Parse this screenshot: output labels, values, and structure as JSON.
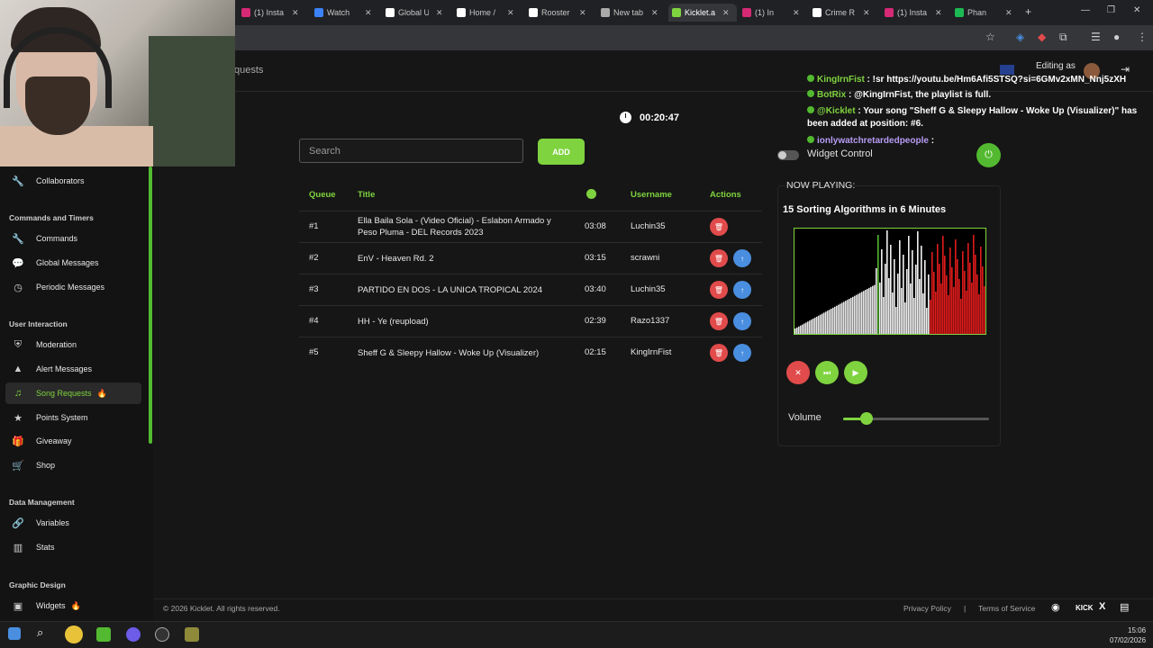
{
  "browser": {
    "tabs": [
      {
        "label": "(1) Insta",
        "color": "#d62976"
      },
      {
        "label": "Watch",
        "color": "#3b82f6"
      },
      {
        "label": "Global U",
        "color": "#ffffff"
      },
      {
        "label": "Home /",
        "color": "#ffffff"
      },
      {
        "label": "Rooster",
        "color": "#ffffff"
      },
      {
        "label": "New tab",
        "color": "#aaaaaa"
      },
      {
        "label": "Kicklet.a",
        "color": "#7fd33f"
      },
      {
        "label": "(1) In",
        "color": "#d62976"
      },
      {
        "label": "Crime R",
        "color": "#ffffff"
      },
      {
        "label": "(1) Insta",
        "color": "#d62976"
      },
      {
        "label": "Phan",
        "color": "#1db954"
      }
    ],
    "new_tab": "+"
  },
  "header": {
    "page_crumb": "quests",
    "editing_as": "Editing as"
  },
  "chat": [
    {
      "name": "KingIrnFist",
      "text": " : !sr https://youtu.be/Hm6Afi5STSQ?si=6GMv2xMN_Nnj5zXH",
      "name_class": "nm-green"
    },
    {
      "name": "BotRix",
      "text": " : @KingIrnFist, the playlist is full.",
      "name_class": "nm-green"
    },
    {
      "name": "@Kicklet",
      "text": " : Your song \"Sheff G & Sleepy Hallow - Woke Up (Visualizer)\" has",
      "name_class": "nm-green"
    },
    {
      "name": "",
      "text": "been added at position: #6.",
      "name_class": ""
    },
    {
      "name": "ionlywatchretardedpeople",
      "text": " :",
      "name_class": "nm-purple"
    }
  ],
  "sidebar": {
    "top_item": "Collaborators",
    "sections": [
      {
        "heading": "Commands and Timers",
        "items": [
          {
            "label": "Commands",
            "icon": "wrench-icon",
            "glyph": "🔧"
          },
          {
            "label": "Global Messages",
            "icon": "chat-bubble-icon",
            "glyph": "💬"
          },
          {
            "label": "Periodic Messages",
            "icon": "clock-icon",
            "glyph": "◷"
          }
        ]
      },
      {
        "heading": "User Interaction",
        "items": [
          {
            "label": "Moderation",
            "icon": "shield-icon",
            "glyph": "⛨"
          },
          {
            "label": "Alert Messages",
            "icon": "warning-icon",
            "glyph": "▲"
          },
          {
            "label": "Song Requests",
            "icon": "music-note-icon",
            "glyph": "♫"
          },
          {
            "label": "Points System",
            "icon": "star-icon",
            "glyph": "★"
          },
          {
            "label": "Giveaway",
            "icon": "gift-icon",
            "glyph": "🎁"
          },
          {
            "label": "Shop",
            "icon": "cart-icon",
            "glyph": "🛒"
          }
        ]
      },
      {
        "heading": "Data Management",
        "items": [
          {
            "label": "Variables",
            "icon": "link-icon",
            "glyph": "🔗"
          },
          {
            "label": "Stats",
            "icon": "bar-chart-icon",
            "glyph": "▥"
          }
        ]
      },
      {
        "heading": "Graphic Design",
        "items": [
          {
            "label": "Widgets",
            "icon": "widget-icon",
            "glyph": "▣"
          }
        ]
      }
    ]
  },
  "queue": {
    "timer": "00:20:47",
    "search_placeholder": "Search",
    "add_label": "ADD",
    "columns": {
      "queue": "Queue",
      "title": "Title",
      "duration_icon": "clock-icon",
      "username": "Username",
      "actions": "Actions"
    },
    "rows": [
      {
        "pos": "#1",
        "title": "Ella Baila Sola - (Video Oficial) - Eslabon Armado y Peso Pluma - DEL Records 2023",
        "duration": "03:08",
        "user": "Luchin35",
        "can_move_up": false
      },
      {
        "pos": "#2",
        "title": "EnV - Heaven Rd. 2",
        "duration": "03:15",
        "user": "scrawni",
        "can_move_up": true
      },
      {
        "pos": "#3",
        "title": "PARTIDO EN DOS - LA UNICA TROPICAL 2024",
        "duration": "03:40",
        "user": "Luchin35",
        "can_move_up": true
      },
      {
        "pos": "#4",
        "title": "HH - Ye (reupload)",
        "duration": "02:39",
        "user": "Razo1337",
        "can_move_up": true
      },
      {
        "pos": "#5",
        "title": "Sheff G & Sleepy Hallow - Woke Up (Visualizer)",
        "duration": "02:15",
        "user": "KingIrnFist",
        "can_move_up": true
      }
    ]
  },
  "player": {
    "widget_control": "Widget Control",
    "now_playing_label": "NOW PLAYING:",
    "now_playing_title": "15 Sorting Algorithms in 6 Minutes",
    "volume_label": "Volume",
    "volume_fraction": 0.16
  },
  "footer": {
    "copyright": "© 2026 Kicklet. All rights reserved.",
    "privacy": "Privacy Policy",
    "divider": "|",
    "terms": "Terms of Service",
    "kick": "KICK",
    "x": "X"
  },
  "taskbar": {
    "time": "15:06",
    "date": "07/02/2026"
  },
  "colors": {
    "accent": "#7fd33f",
    "danger": "#e14b4b",
    "info": "#4a8ee0"
  }
}
